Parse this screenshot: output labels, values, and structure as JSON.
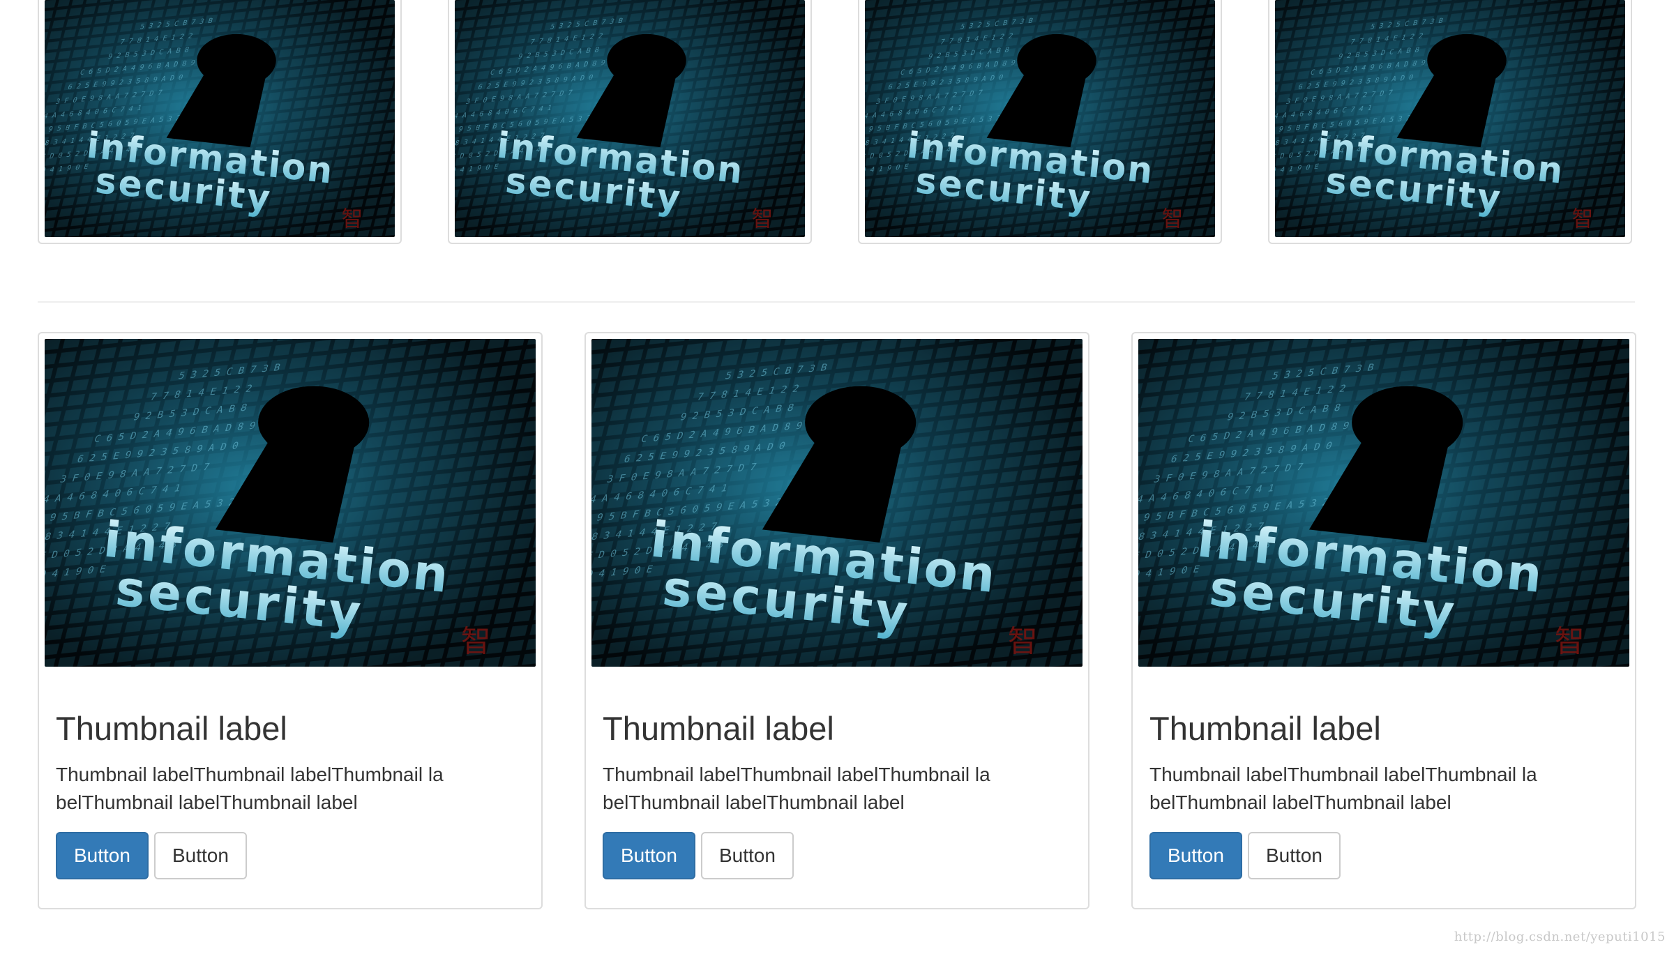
{
  "image": {
    "lines": [
      "information",
      "security"
    ],
    "icon": "keyhole-icon",
    "colors": {
      "bg_dark": "#02090d",
      "bg_glow": "#1b6d86",
      "digits": "#5fb6cf",
      "text_light": "#d4f3fb",
      "text_mid": "#6cc4de",
      "stamp": "#7a1410"
    }
  },
  "small_thumbnails": [
    {
      "id": "thumb-1"
    },
    {
      "id": "thumb-2"
    },
    {
      "id": "thumb-3"
    },
    {
      "id": "thumb-4"
    }
  ],
  "cards": [
    {
      "title": "Thumbnail label",
      "text": "Thumbnail labelThumbnail labelThumbnail labelThumbnail labelThumbnail label",
      "primary_button": "Button",
      "default_button": "Button"
    },
    {
      "title": "Thumbnail label",
      "text": "Thumbnail labelThumbnail labelThumbnail labelThumbnail labelThumbnail label",
      "primary_button": "Button",
      "default_button": "Button"
    },
    {
      "title": "Thumbnail label",
      "text": "Thumbnail labelThumbnail labelThumbnail labelThumbnail labelThumbnail label",
      "primary_button": "Button",
      "default_button": "Button"
    }
  ],
  "colors": {
    "primary": "#337ab7",
    "border": "#dddddd",
    "text": "#333333"
  },
  "watermark": "http://blog.csdn.net/yeputi1015"
}
